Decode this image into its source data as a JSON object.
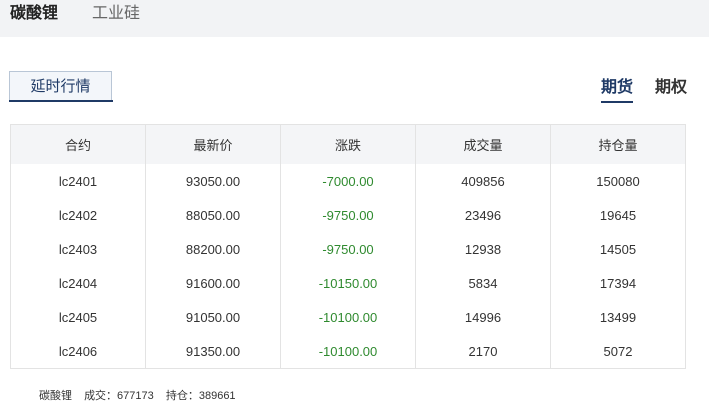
{
  "top_tabs": [
    "碳酸锂",
    "工业硅"
  ],
  "sub_tab": "延时行情",
  "modes": [
    "期货",
    "期权"
  ],
  "table": {
    "headers": [
      "合约",
      "最新价",
      "涨跌",
      "成交量",
      "持仓量"
    ],
    "rows": [
      [
        "lc2401",
        "93050.00",
        "-7000.00",
        "409856",
        "150080"
      ],
      [
        "lc2402",
        "88050.00",
        "-9750.00",
        "23496",
        "19645"
      ],
      [
        "lc2403",
        "88200.00",
        "-9750.00",
        "12938",
        "14505"
      ],
      [
        "lc2404",
        "91600.00",
        "-10150.00",
        "5834",
        "17394"
      ],
      [
        "lc2405",
        "91050.00",
        "-10100.00",
        "14996",
        "13499"
      ],
      [
        "lc2406",
        "91350.00",
        "-10100.00",
        "2170",
        "5072"
      ]
    ]
  },
  "summary": {
    "product": "碳酸锂",
    "volume_label": "成交：677173",
    "open_interest_label": "持仓：389661"
  },
  "colors": {
    "down": "#2f8a2f",
    "accent": "#1f3a66"
  }
}
